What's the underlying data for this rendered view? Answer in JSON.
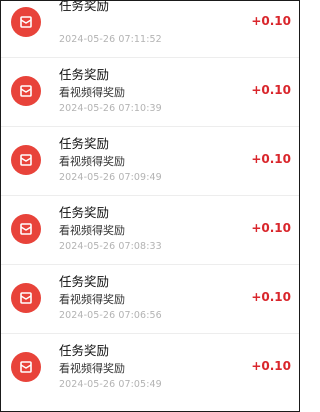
{
  "records": [
    {
      "title": "任务奖励",
      "subtitle": "",
      "time": "2024-05-26 07:11:52",
      "amount": "+0.10",
      "icon": "red-packet-icon"
    },
    {
      "title": "任务奖励",
      "subtitle": "看视频得奖励",
      "time": "2024-05-26 07:10:39",
      "amount": "+0.10",
      "icon": "red-packet-icon"
    },
    {
      "title": "任务奖励",
      "subtitle": "看视频得奖励",
      "time": "2024-05-26 07:09:49",
      "amount": "+0.10",
      "icon": "red-packet-icon"
    },
    {
      "title": "任务奖励",
      "subtitle": "看视频得奖励",
      "time": "2024-05-26 07:08:33",
      "amount": "+0.10",
      "icon": "red-packet-icon"
    },
    {
      "title": "任务奖励",
      "subtitle": "看视频得奖励",
      "time": "2024-05-26 07:06:56",
      "amount": "+0.10",
      "icon": "red-packet-icon"
    },
    {
      "title": "任务奖励",
      "subtitle": "看视频得奖励",
      "time": "2024-05-26 07:05:49",
      "amount": "+0.10",
      "icon": "red-packet-icon"
    }
  ],
  "colors": {
    "amount": "#d9262c",
    "icon_bg": "#e8433a",
    "timestamp": "#b3b3b3"
  }
}
